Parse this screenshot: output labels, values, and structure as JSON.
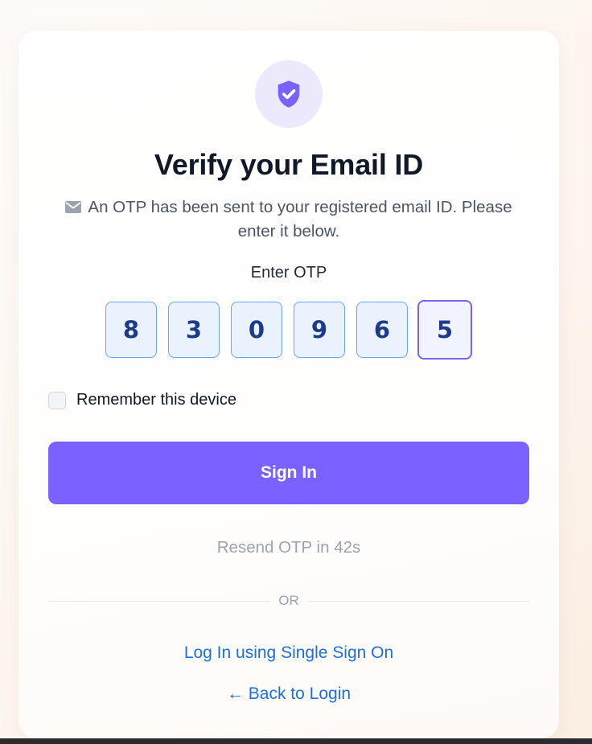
{
  "header": {
    "title": "Verify your Email ID",
    "subtitle": "An OTP has been sent to your registered email ID. Please enter it below."
  },
  "otp": {
    "label": "Enter OTP",
    "digits": [
      "8",
      "3",
      "0",
      "9",
      "6",
      "5"
    ],
    "active_index": 5
  },
  "remember": {
    "label": "Remember this device",
    "checked": false
  },
  "actions": {
    "signin_label": "Sign In",
    "resend_label": "Resend OTP in 42s",
    "divider_label": "OR",
    "sso_label": "Log In using Single Sign On",
    "back_label": "← Back to Login"
  },
  "icons": {
    "shield": "shield-check-icon",
    "mail": "mail-icon"
  },
  "colors": {
    "primary": "#7b61ff",
    "link": "#1d6fe0",
    "otp_border": "#6aa6ec",
    "otp_active_border": "#7a63f1"
  }
}
